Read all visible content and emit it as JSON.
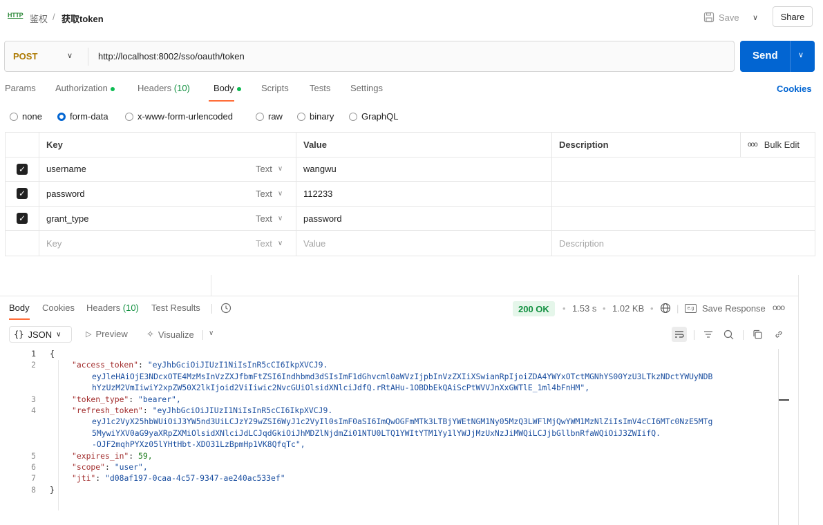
{
  "header": {
    "http_badge": "HTTP",
    "breadcrumb_parent": "鉴权",
    "breadcrumb_sep": "/",
    "breadcrumb_current": "获取token",
    "save_label": "Save",
    "share_label": "Share"
  },
  "request": {
    "method": "POST",
    "url": "http://localhost:8002/sso/oauth/token",
    "send_label": "Send"
  },
  "request_tabs": {
    "params": "Params",
    "authorization": "Authorization",
    "headers": "Headers",
    "headers_count": "(10)",
    "body": "Body",
    "scripts": "Scripts",
    "tests": "Tests",
    "settings": "Settings",
    "cookies": "Cookies"
  },
  "body_types": {
    "none": "none",
    "form_data": "form-data",
    "urlencoded": "x-www-form-urlencoded",
    "raw": "raw",
    "binary": "binary",
    "graphql": "GraphQL",
    "selected": "form-data"
  },
  "params_table": {
    "headers": {
      "key": "Key",
      "value": "Value",
      "description": "Description",
      "bulk_edit": "Bulk Edit"
    },
    "rows": [
      {
        "key": "username",
        "type": "Text",
        "value": "wangwu",
        "description": "",
        "checked": true
      },
      {
        "key": "password",
        "type": "Text",
        "value": "112233",
        "description": "",
        "checked": true
      },
      {
        "key": "grant_type",
        "type": "Text",
        "value": "password",
        "description": "",
        "checked": true
      }
    ],
    "placeholder": {
      "key": "Key",
      "type": "Text",
      "value": "Value",
      "description": "Description"
    }
  },
  "response_tabs": {
    "body": "Body",
    "cookies": "Cookies",
    "headers": "Headers",
    "headers_count": "(10)",
    "test_results": "Test Results"
  },
  "response_meta": {
    "status": "200 OK",
    "time": "1.53 s",
    "size": "1.02 KB",
    "save_response": "Save Response"
  },
  "response_toolbar": {
    "format": "JSON",
    "preview": "Preview",
    "visualize": "Visualize"
  },
  "response_body": {
    "lines": [
      {
        "n": "1",
        "text": "{"
      },
      {
        "n": "2",
        "key": "\"access_token\"",
        "value": "\"eyJhbGciOiJIUzI1NiIsInR5cCI6IkpXVCJ9.",
        "cont": [
          "eyJleHAiOjE3NDcxOTE4MzMsInVzZXJfbmFtZSI6Indhbmd3dSIsImF1dGhvcml0aWVzIjpbInVzZXIiXSwianRpIjoiZDA4YWYxOTctMGNhYS00YzU3LTkzNDctYWUyNDB",
          "hYzUzM2VmIiwiY2xpZW50X2lkIjoid2ViIiwic2NvcGUiOlsidXNlciJdfQ.rRtAHu-1OBDbEkQAiScPtWVVJnXxGWTlE_1ml4bFnHM\","
        ]
      },
      {
        "n": "3",
        "key": "\"token_type\"",
        "value": "\"bearer\","
      },
      {
        "n": "4",
        "key": "\"refresh_token\"",
        "value": "\"eyJhbGciOiJIUzI1NiIsInR5cCI6IkpXVCJ9.",
        "cont": [
          "eyJ1c2VyX25hbWUiOiJ3YW5nd3UiLCJzY29wZSI6WyJ1c2VyIl0sImF0aSI6ImQwOGFmMTk3LTBjYWEtNGM1Ny05MzQ3LWFlMjQwYWM1MzNlZiIsImV4cCI6MTc0NzE5MTg",
          "5MywiYXV0aG9yaXRpZXMiOlsidXNlciJdLCJqdGkiOiJhMDZlNjdmZi01NTU0LTQ1YWItYTM1Yy1lYWJjMzUxNzJiMWQiLCJjbGllbnRfaWQiOiJ3ZWIifQ.",
          "-OJF2mqhPYXz05lYHtHbt-XDO31LzBpmHp1VK8QfqTc\","
        ]
      },
      {
        "n": "5",
        "key": "\"expires_in\"",
        "value": "59,",
        "numeric": true
      },
      {
        "n": "6",
        "key": "\"scope\"",
        "value": "\"user\","
      },
      {
        "n": "7",
        "key": "\"jti\"",
        "value": "\"d08af197-0caa-4c57-9347-ae240ac533ef\""
      },
      {
        "n": "8",
        "text": "}"
      }
    ]
  },
  "colors": {
    "accent": "#ff6c37",
    "send": "#0265d2",
    "method": "#ad7a03",
    "status_ok": "#0f8f3e"
  }
}
